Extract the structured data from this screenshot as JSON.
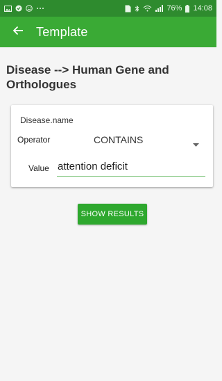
{
  "statusbar": {
    "left_icons": [
      "image-icon",
      "check-shield-icon",
      "smiley-icon",
      "overflow-dots-icon"
    ],
    "right_icons": [
      "sim-icon",
      "bluetooth-icon",
      "wifi-icon",
      "signal-icon",
      "battery-icon"
    ],
    "battery": "76%",
    "time": "14:08"
  },
  "appbar": {
    "title": "Template",
    "back_icon": "arrow-left-icon"
  },
  "heading": "Disease --> Human Gene and Orthologues",
  "constraint": {
    "field_name": "Disease.name",
    "operator_label": "Operator",
    "operator_value": "CONTAINS",
    "value_label": "Value",
    "value": "attention deficit"
  },
  "show_results_label": "SHOW RESULTS",
  "colors": {
    "statusbar": "#2e8b2e",
    "appbar": "#3aaa35",
    "button": "#2ea82e",
    "underline": "#7cc47a"
  }
}
